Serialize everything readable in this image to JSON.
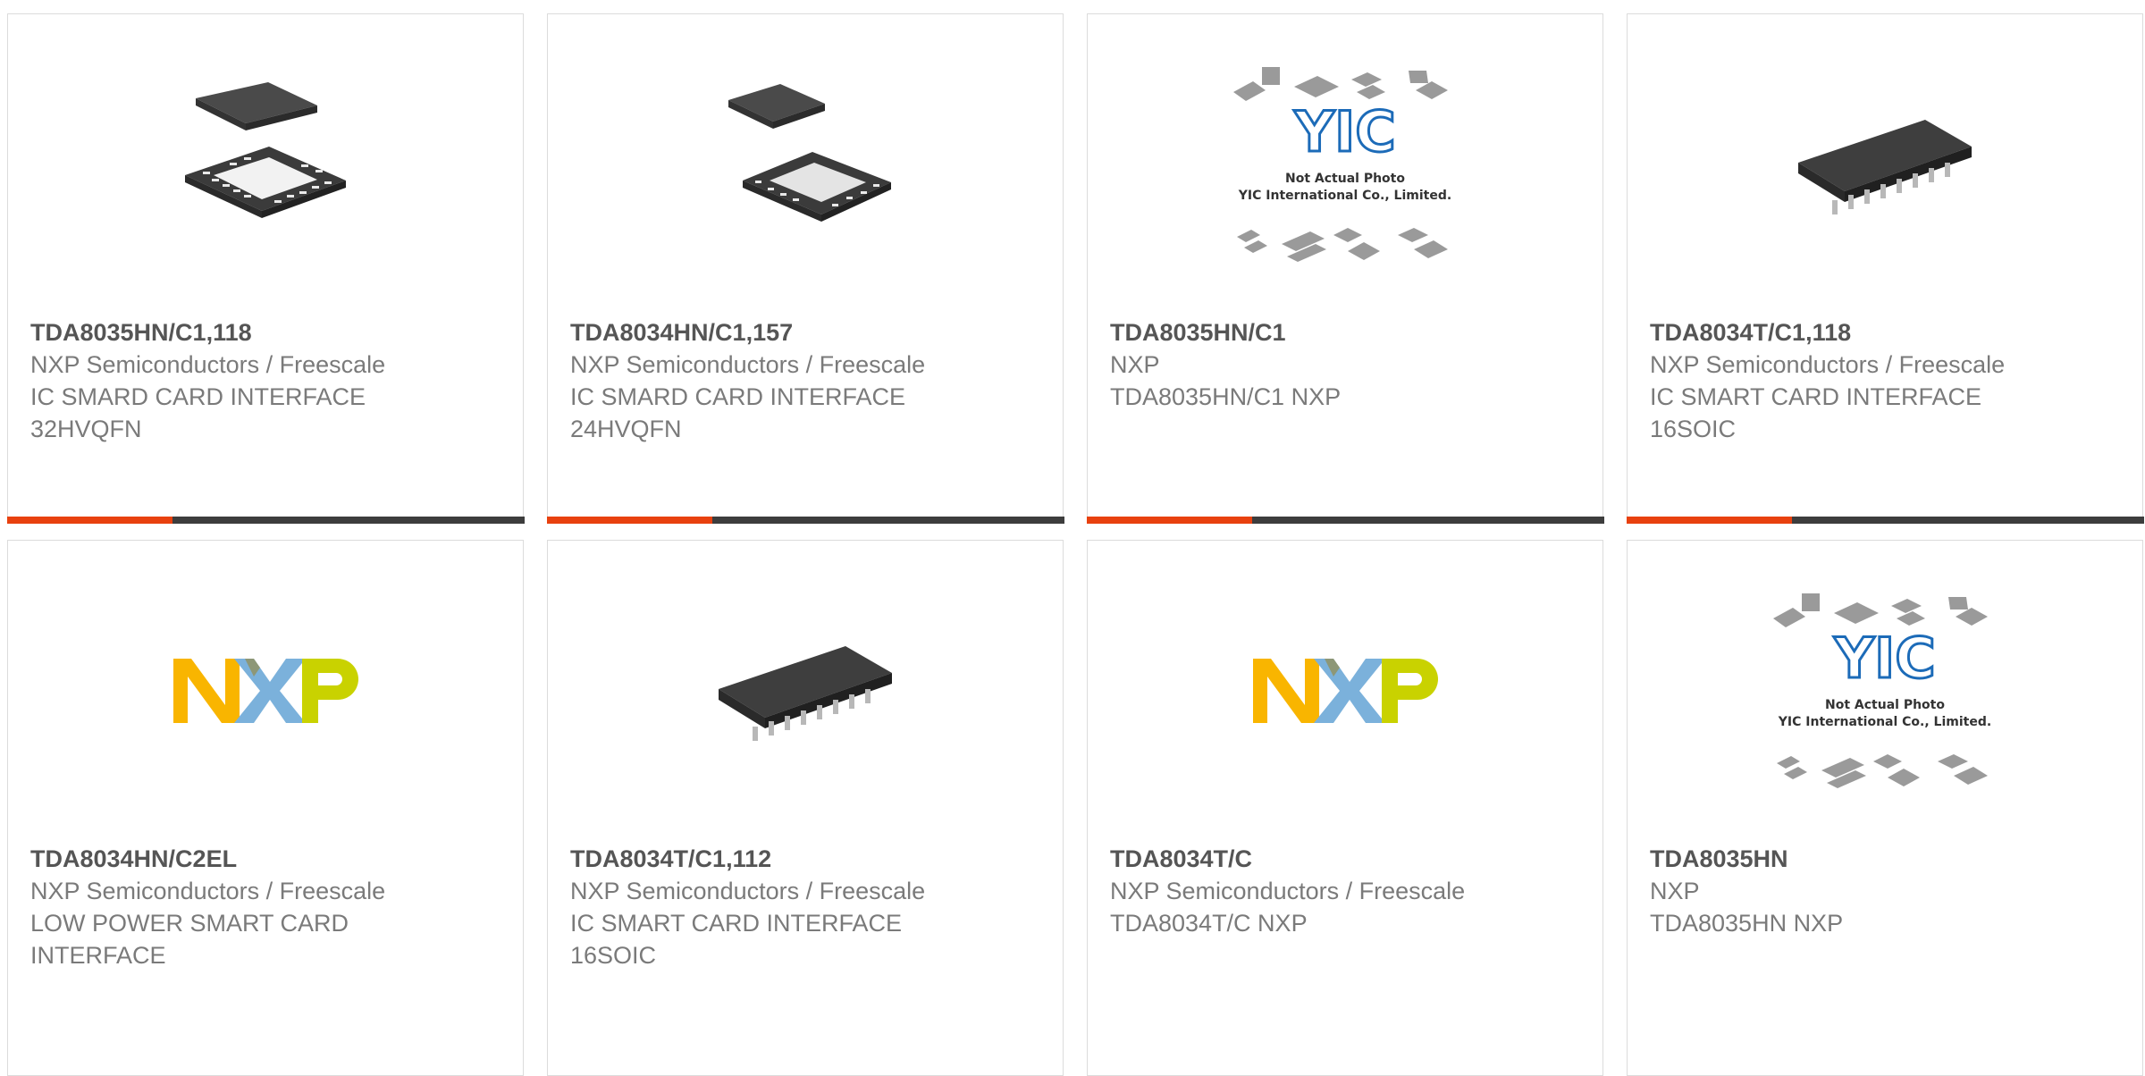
{
  "colors": {
    "accent_orange": "#e8410f",
    "accent_dark": "#3d3d3d",
    "title_text": "#555555",
    "body_text": "#7a7a7a",
    "border": "#dcdcdc"
  },
  "products": [
    {
      "part_number": "TDA8035HN/C1,118",
      "manufacturer": "NXP Semiconductors / Freescale",
      "desc_line1": "IC SMARD CARD INTERFACE",
      "desc_line2": "32HVQFN",
      "image": "qfn-32-chip",
      "hover_progress": 0.32
    },
    {
      "part_number": "TDA8034HN/C1,157",
      "manufacturer": "NXP Semiconductors / Freescale",
      "desc_line1": "IC SMARD CARD INTERFACE",
      "desc_line2": "24HVQFN",
      "image": "qfn-24-chip",
      "hover_progress": 0.32
    },
    {
      "part_number": "TDA8035HN/C1",
      "manufacturer": "NXP",
      "desc_line1": "TDA8035HN/C1 NXP",
      "desc_line2": "",
      "image": "yic-placeholder",
      "placeholder_logo": "YIC",
      "placeholder_line1": "Not Actual Photo",
      "placeholder_line2": "YIC International Co., Limited.",
      "hover_progress": 0.32
    },
    {
      "part_number": "TDA8034T/C1,118",
      "manufacturer": "NXP Semiconductors / Freescale",
      "desc_line1": "IC SMART CARD INTERFACE",
      "desc_line2": "16SOIC",
      "image": "soic-16-chip",
      "hover_progress": 0.32
    },
    {
      "part_number": "TDA8034HN/C2EL",
      "manufacturer": "NXP Semiconductors / Freescale",
      "desc_line1": "LOW POWER SMART CARD",
      "desc_line2": "INTERFACE",
      "image": "nxp-logo"
    },
    {
      "part_number": "TDA8034T/C1,112",
      "manufacturer": "NXP Semiconductors / Freescale",
      "desc_line1": "IC SMART CARD INTERFACE",
      "desc_line2": "16SOIC",
      "image": "soic-16-chip"
    },
    {
      "part_number": "TDA8034T/C",
      "manufacturer": "NXP Semiconductors / Freescale",
      "desc_line1": "TDA8034T/C NXP",
      "desc_line2": "",
      "image": "nxp-logo"
    },
    {
      "part_number": "TDA8035HN",
      "manufacturer": "NXP",
      "desc_line1": "TDA8035HN NXP",
      "desc_line2": "",
      "image": "yic-placeholder",
      "placeholder_logo": "YIC",
      "placeholder_line1": "Not Actual Photo",
      "placeholder_line2": "YIC International Co., Limited."
    }
  ]
}
